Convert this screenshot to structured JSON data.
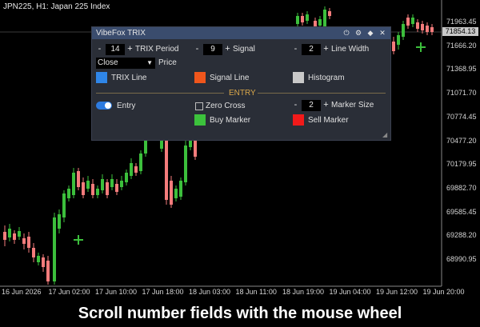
{
  "chart": {
    "title": "JPN225, H1:  Japan 225 Index",
    "price_tag": "71854.13",
    "y_labels": [
      "71963.45",
      "71666.20",
      "71368.95",
      "71071.70",
      "70774.45",
      "70477.20",
      "70179.95",
      "69882.70",
      "69585.45",
      "69288.20",
      "68990.95"
    ],
    "x_labels": [
      "16 Jun 2026",
      "17 Jun 02:00",
      "17 Jun 10:00",
      "17 Jun 18:00",
      "18 Jun 03:00",
      "18 Jun 11:00",
      "18 Jun 19:00",
      "19 Jun 04:00",
      "19 Jun 12:00",
      "19 Jun 20:00"
    ],
    "up_color": "#3cbf3c",
    "down_color": "#f47c7c",
    "grid_color": "#2a2a2a"
  },
  "panel": {
    "title": "VibeFox TRIX",
    "header_icons": [
      "power-icon",
      "settings-icon",
      "pin-icon",
      "close-icon"
    ],
    "header_glyphs": {
      "power": "⏻",
      "settings": "⚙",
      "pin": "◆",
      "close": "✕"
    },
    "trix_period": {
      "value": "14",
      "label": "TRIX Period"
    },
    "signal": {
      "value": "9",
      "label": "Signal"
    },
    "line_width": {
      "value": "2",
      "label": "Line Width"
    },
    "minus": "-",
    "plus": "+",
    "price_select": {
      "value": "Close",
      "label": "Price",
      "caret": "▼"
    },
    "trix_line": {
      "label": "TRIX Line",
      "color": "#2f86e8"
    },
    "signal_line": {
      "label": "Signal Line",
      "color": "#f0561c"
    },
    "histogram": {
      "label": "Histogram",
      "color": "#c9c9c9"
    },
    "section_entry": "ENTRY",
    "entry_toggle": {
      "label": "Entry",
      "on": true
    },
    "zero_cross": {
      "label": "Zero Cross",
      "checked": false
    },
    "marker_size": {
      "value": "2",
      "label": "Marker Size"
    },
    "buy_marker": {
      "label": "Buy Marker",
      "color": "#3cc23c"
    },
    "sell_marker": {
      "label": "Sell Marker",
      "color": "#f21a1a"
    }
  },
  "banner": {
    "text": "Scroll number fields with the mouse wheel"
  }
}
